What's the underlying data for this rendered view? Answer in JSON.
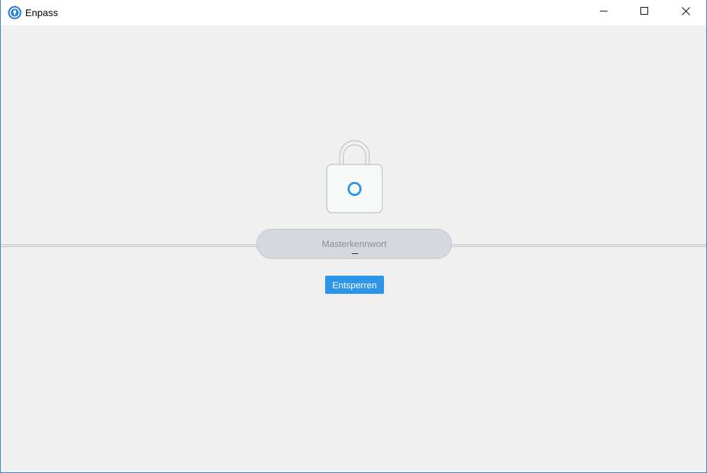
{
  "window": {
    "title": "Enpass",
    "app_icon": "enpass-logo-icon",
    "controls": {
      "minimize_icon": "minimize-icon",
      "maximize_icon": "maximize-icon",
      "close_icon": "close-icon"
    }
  },
  "lock_screen": {
    "lock_icon": "padlock-icon",
    "password_field": {
      "placeholder": "Masterkennwort",
      "value": ""
    },
    "unlock_button_label": "Entsperren"
  },
  "colors": {
    "accent": "#2d96e8",
    "background": "#f0f0f0",
    "window_border": "#2b7bd3"
  }
}
